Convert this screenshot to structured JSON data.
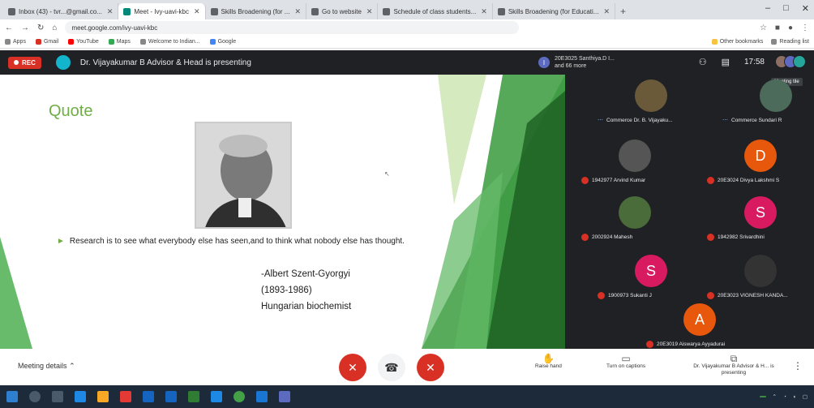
{
  "browser": {
    "tabs": [
      {
        "label": "Inbox (43) - tvr...@gmail.co...",
        "active": false
      },
      {
        "label": "Meet - Ivy-uavi-kbc",
        "active": true
      },
      {
        "label": "Skills Broadening (for ...",
        "active": false
      },
      {
        "label": "Go to website",
        "active": false
      },
      {
        "label": "Schedule of class students...",
        "active": false
      },
      {
        "label": "Skills Broadening (for Educati...",
        "active": false
      }
    ],
    "new_tab": "+",
    "window_controls": [
      "–",
      "□",
      "✕"
    ],
    "url": "meet.google.com/ivy-uavi-kbc",
    "bookmarks": [
      "Apps",
      "Gmail",
      "YouTube",
      "Maps",
      "Welcome to Indian...",
      "Google"
    ],
    "bookmarks_right": [
      "Other bookmarks",
      "Reading list"
    ]
  },
  "meet": {
    "rec_label": "REC",
    "presenting_text": "Dr. Vijayakumar B Advisor & Head is presenting",
    "join_note": {
      "initial": "I",
      "line1": "20E3025 Santhiya.D I...",
      "line2": "and 66 more"
    },
    "clock": "17:58",
    "tooltip": "Meeting tile",
    "meeting_details": "Meeting details",
    "controls": {
      "raise_hand": "Raise hand",
      "captions": "Turn on captions",
      "presenting": "Dr. Vijayakumar B Advisor & H... is presenting"
    }
  },
  "slide": {
    "title": "Quote",
    "quote": "Research is to see what everybody else has seen,and to think what nobody else has thought.",
    "author_lines": [
      "-Albert Szent-Gyorgyi",
      "(1893-1986)",
      "Hungarian biochemist"
    ]
  },
  "participants": [
    {
      "name": "Commerce Dr. B. Vijayaku...",
      "type": "photo",
      "muted": false,
      "color": "#6b5a3a"
    },
    {
      "name": "Commerce Sundari R",
      "type": "photo",
      "muted": false,
      "color": "#4d6b5a"
    },
    {
      "name": "1942977 Arvind Kumar",
      "type": "photo",
      "muted": true,
      "color": "#555555"
    },
    {
      "name": "20E3024 Divya Lakshmi S",
      "type": "letter",
      "letter": "D",
      "muted": true,
      "color": "#e8580c"
    },
    {
      "name": "2002924 Mahesh",
      "type": "photo",
      "muted": true,
      "color": "#4a6b3a"
    },
    {
      "name": "1942982 Srivardhini",
      "type": "letter",
      "letter": "S",
      "muted": true,
      "color": "#d81b60"
    },
    {
      "name": "1900973 Sukanti J",
      "type": "letter",
      "letter": "S",
      "muted": true,
      "color": "#d81b60"
    },
    {
      "name": "20E3023 VIGNESH KANDA...",
      "type": "photo",
      "muted": true,
      "color": "#333333"
    },
    {
      "name": "20E3019 Aiswarya Ayyadurai",
      "type": "letter",
      "letter": "A",
      "muted": true,
      "color": "#e8580c"
    }
  ],
  "colors": {
    "accent_green": "#70ad47",
    "meet_dark": "#202124",
    "red": "#d93025"
  }
}
